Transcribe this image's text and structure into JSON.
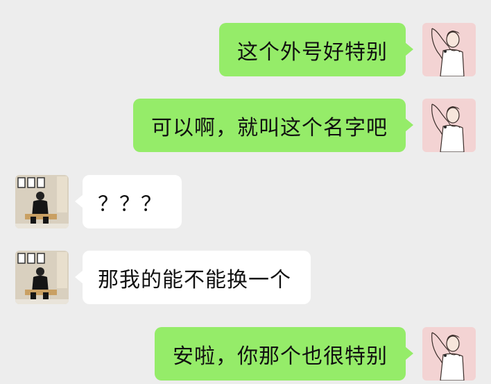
{
  "messages": [
    {
      "sender": "self",
      "avatar": "woman-avatar",
      "text": "这个外号好特别"
    },
    {
      "sender": "self",
      "avatar": "woman-avatar",
      "text": "可以啊，就叫这个名字吧"
    },
    {
      "sender": "other",
      "avatar": "man-avatar",
      "text": "？？？"
    },
    {
      "sender": "other",
      "avatar": "man-avatar",
      "text": "那我的能不能换一个"
    },
    {
      "sender": "self",
      "avatar": "woman-avatar",
      "text": "安啦，你那个也很特别"
    }
  ],
  "colors": {
    "background": "#ededed",
    "self_bubble": "#95ec69",
    "other_bubble": "#ffffff",
    "self_avatar_bg": "#f3d3d3",
    "other_avatar_bg": "#d9d0bf"
  }
}
